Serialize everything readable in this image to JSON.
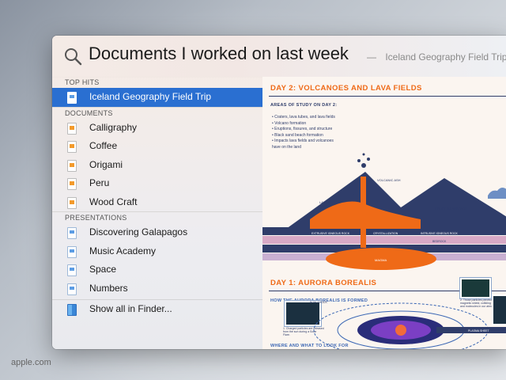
{
  "search": {
    "query": "Documents I worked on last week",
    "suggestion_dash": "—",
    "suggestion": "Iceland Geography Field Trip"
  },
  "sidebar": {
    "sections": [
      {
        "label": "TOP HITS",
        "items": [
          {
            "label": "Iceland Geography Field Trip",
            "icon": "keynote-doc-icon"
          }
        ]
      },
      {
        "label": "DOCUMENTS",
        "items": [
          {
            "label": "Calligraphy",
            "icon": "pages-doc-icon"
          },
          {
            "label": "Coffee",
            "icon": "pages-doc-icon"
          },
          {
            "label": "Origami",
            "icon": "pages-doc-icon"
          },
          {
            "label": "Peru",
            "icon": "pages-doc-icon"
          },
          {
            "label": "Wood Craft",
            "icon": "pages-doc-icon"
          }
        ]
      },
      {
        "label": "PRESENTATIONS",
        "items": [
          {
            "label": "Discovering Galapagos",
            "icon": "keynote-doc-icon"
          },
          {
            "label": "Music Academy",
            "icon": "keynote-doc-icon"
          },
          {
            "label": "Space",
            "icon": "keynote-doc-icon"
          },
          {
            "label": "Numbers",
            "icon": "keynote-doc-icon"
          }
        ]
      }
    ],
    "show_all": "Show all in Finder..."
  },
  "preview": {
    "day2_title": "DAY 2: VOLCANOES AND LAVA FIELDS",
    "day2_sub": "AREAS OF STUDY ON DAY 2:",
    "bullets": [
      "• Craters, lava tubes, and lava fields",
      "• Volcano formation",
      "• Eruptions, fissures, and structure",
      "• Black sand beach formation",
      "• Impacts lava fields and volcanoes",
      "   have on the land"
    ],
    "labels": {
      "volcanic_ash": "VOLCANIC ASH",
      "lava": "LAVA",
      "uplift": "UPLIFT TO SURFACE",
      "igneous": "EXTRUSIVE IGNEOUS ROCK",
      "crystal": "CRYSTALLIZATION",
      "intrusive": "INTRUSIVE IGNEOUS ROCK",
      "bedrock": "BEDROCK",
      "magma": "MAGMA"
    },
    "day1_title": "DAY 1: AURORA BOREALIS",
    "day1_sub": "HOW THE AURORA BOREALIS IS FORMED",
    "captions": {
      "c1": "1. Charged particles are released from the sun during a Solar Flare.",
      "c2": "2. Those particles penetrate Earth's magnetic shield, colliding with atoms and molecules in our atmosphere.",
      "bow_shock": "BOW SHOCK",
      "plasma": "PLASMA SHEET"
    },
    "where_title": "WHERE AND WHAT TO LOOK FOR"
  },
  "watermark": "apple.com",
  "colors": {
    "selection": "#2a6fd1",
    "accent_orange": "#ef6a17",
    "navy": "#2f3d6a"
  }
}
